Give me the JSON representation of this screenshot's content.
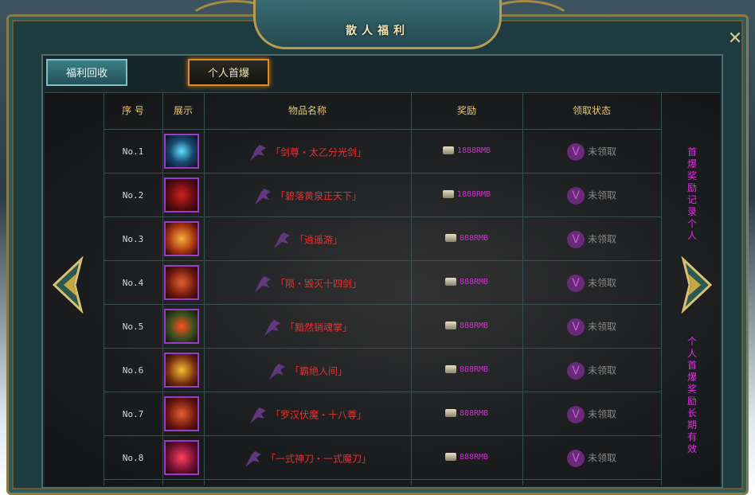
{
  "window": {
    "title": "散人福利",
    "close_symbol": "✕"
  },
  "tabs": [
    {
      "label": "福利回收",
      "active": false
    },
    {
      "label": "个人首爆",
      "active": true
    }
  ],
  "table": {
    "headers": [
      "序 号",
      "展示",
      "物品名称",
      "奖励",
      "领取状态"
    ],
    "rows": [
      {
        "no": "No.1",
        "name": "「剑尊・太乙分光剑」",
        "reward": "1888RMB",
        "status": "未领取"
      },
      {
        "no": "No.2",
        "name": "「碧落黄泉正天下」",
        "reward": "1888RMB",
        "status": "未领取"
      },
      {
        "no": "No.3",
        "name": "「逍遥游」",
        "reward": "888RMB",
        "status": "未领取"
      },
      {
        "no": "No.4",
        "name": "「陨・毁灭十四剑」",
        "reward": "888RMB",
        "status": "未领取"
      },
      {
        "no": "No.5",
        "name": "「黯然销魂掌」",
        "reward": "888RMB",
        "status": "未领取"
      },
      {
        "no": "No.6",
        "name": "「霸绝人间」",
        "reward": "888RMB",
        "status": "未领取"
      },
      {
        "no": "No.7",
        "name": "「罗汉伏魔・十八尊」",
        "reward": "888RMB",
        "status": "未领取"
      },
      {
        "no": "No.8",
        "name": "「一式神刀・一式魔刀」",
        "reward": "888RMB",
        "status": "未领取"
      }
    ]
  },
  "side_notes": {
    "top": "首爆奖励记录个人",
    "bottom": "个人首爆奖励长期有效"
  },
  "colors": {
    "accent_gold": "#e8c870",
    "item_red": "#e83030",
    "reward_magenta": "#d030d0",
    "tab_active_border": "#e08a20"
  }
}
